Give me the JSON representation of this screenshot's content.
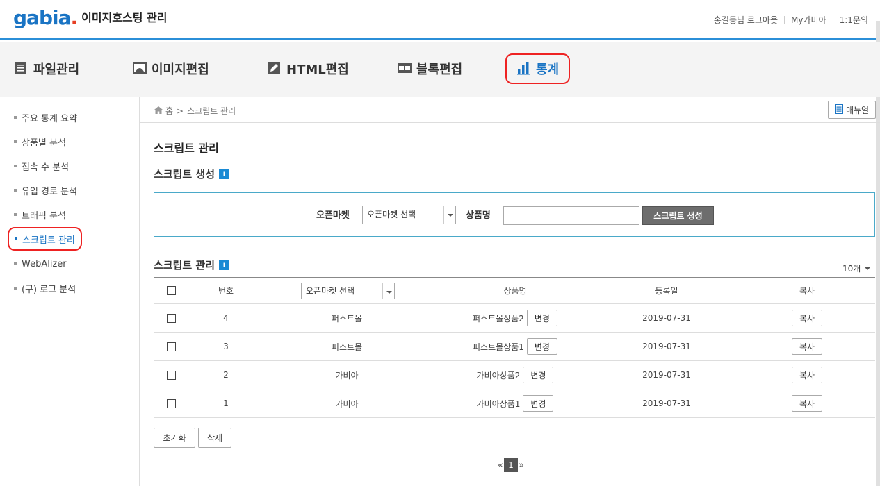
{
  "header": {
    "logo_text": "gabia",
    "logo_dot": ".",
    "title": "이미지호스팅 관리",
    "links": [
      "홍길동님 로그아웃",
      "My가비아",
      "1:1문의"
    ]
  },
  "mainnav": {
    "items": [
      {
        "label": "파일관리",
        "icon": "file-list-icon"
      },
      {
        "label": "이미지편집",
        "icon": "image-icon"
      },
      {
        "label": "HTML편집",
        "icon": "pencil-icon"
      },
      {
        "label": "블록편집",
        "icon": "block-icon"
      },
      {
        "label": "통계",
        "icon": "bar-chart-icon",
        "active": true
      }
    ]
  },
  "sidebar": {
    "items": [
      {
        "label": "주요 통계 요약"
      },
      {
        "label": "상품별 분석"
      },
      {
        "label": "접속 수 분석"
      },
      {
        "label": "유입 경로 분석"
      },
      {
        "label": "트래픽 분석"
      },
      {
        "label": "스크립트 관리",
        "active": true
      },
      {
        "label": "WebAlizer"
      },
      {
        "label": "(구) 로그 분석"
      }
    ]
  },
  "breadcrumb": {
    "home": "홈",
    "sep": ">",
    "current": "스크립트 관리"
  },
  "manual_label": "매뉴얼",
  "page_title": "스크립트 관리",
  "create": {
    "title": "스크립트 생성",
    "info": "i",
    "openmarket_label": "오픈마켓",
    "openmarket_select": "오픈마켓 선택",
    "product_label": "상품명",
    "product_value": "",
    "create_button": "스크립트 생성"
  },
  "manage": {
    "title": "스크립트 관리",
    "info": "i",
    "count_select": "10개",
    "columns": {
      "no": "번호",
      "market_select": "오픈마켓 선택",
      "product": "상품명",
      "date": "등록일",
      "copy": "복사"
    },
    "rows": [
      {
        "no": "4",
        "market": "퍼스트몰",
        "product": "퍼스트몰상품2",
        "change": "변경",
        "date": "2019-07-31",
        "copy": "복사"
      },
      {
        "no": "3",
        "market": "퍼스트몰",
        "product": "퍼스트몰상품1",
        "change": "변경",
        "date": "2019-07-31",
        "copy": "복사"
      },
      {
        "no": "2",
        "market": "가비아",
        "product": "가비아상품2",
        "change": "변경",
        "date": "2019-07-31",
        "copy": "복사"
      },
      {
        "no": "1",
        "market": "가비아",
        "product": "가비아상품1",
        "change": "변경",
        "date": "2019-07-31",
        "copy": "복사"
      }
    ],
    "reset_button": "초기화",
    "delete_button": "삭제"
  },
  "pager": {
    "prev": "«",
    "current": "1",
    "next": "»"
  },
  "colors": {
    "accent": "#1a74c4",
    "highlight": "#e22222",
    "logo_dot": "#e63f24"
  }
}
